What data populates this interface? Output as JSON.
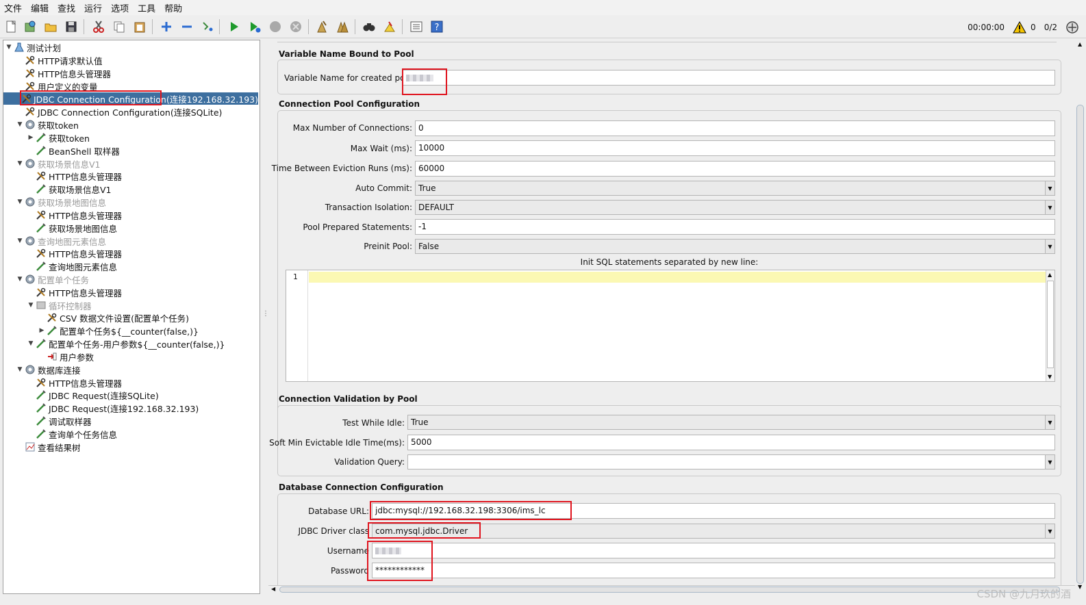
{
  "menu": [
    "文件",
    "编辑",
    "查找",
    "运行",
    "选项",
    "工具",
    "帮助"
  ],
  "toolbar": {
    "icons": [
      "new-icon",
      "templates-icon",
      "open-icon",
      "save-icon",
      "cut-icon",
      "copy-icon",
      "paste-icon",
      "expand-icon",
      "collapse-icon",
      "toggle-icon",
      "start-icon",
      "start-no-pause-icon",
      "stop-icon",
      "shutdown-icon",
      "clear-icon",
      "clear-all-icon",
      "search-icon",
      "reset-search-icon",
      "function-helper-icon",
      "help-icon"
    ],
    "elapsed": "00:00:00",
    "warnings": "0",
    "threads": "0/2"
  },
  "tree": [
    {
      "label": "测试计划",
      "icon": "testplan-icon",
      "expander": "▼"
    },
    {
      "label": "HTTP请求默认值",
      "icon": "config-icon"
    },
    {
      "label": "HTTP信息头管理器",
      "icon": "config-icon"
    },
    {
      "label": "用户定义的变量",
      "icon": "config-icon"
    },
    {
      "label": "JDBC Connection Configuration(连接192.168.32.193)",
      "icon": "config-icon"
    },
    {
      "label": "JDBC Connection Configuration(连接SQLite)",
      "icon": "config-icon"
    },
    {
      "label": "获取token",
      "icon": "threadgroup-icon",
      "expander": "▼"
    },
    {
      "label": "获取token",
      "icon": "sampler-icon",
      "expander": "▶"
    },
    {
      "label": "BeanShell 取样器",
      "icon": "sampler-icon"
    },
    {
      "label": "获取场景信息V1",
      "icon": "threadgroup-icon",
      "expander": "▼"
    },
    {
      "label": "HTTP信息头管理器",
      "icon": "config-icon"
    },
    {
      "label": "获取场景信息V1",
      "icon": "sampler-icon"
    },
    {
      "label": "获取场景地图信息",
      "icon": "threadgroup-icon",
      "expander": "▼"
    },
    {
      "label": "HTTP信息头管理器",
      "icon": "config-icon"
    },
    {
      "label": "获取场景地图信息",
      "icon": "sampler-icon"
    },
    {
      "label": "查询地图元素信息",
      "icon": "threadgroup-icon",
      "expander": "▼"
    },
    {
      "label": "HTTP信息头管理器",
      "icon": "config-icon"
    },
    {
      "label": "查询地图元素信息",
      "icon": "sampler-icon"
    },
    {
      "label": "配置单个任务",
      "icon": "threadgroup-icon",
      "expander": "▼"
    },
    {
      "label": "HTTP信息头管理器",
      "icon": "config-icon"
    },
    {
      "label": "循环控制器",
      "icon": "loop-icon",
      "expander": "▼"
    },
    {
      "label": "CSV 数据文件设置(配置单个任务)",
      "icon": "config-icon"
    },
    {
      "label": "配置单个任务${__counter(false,)}",
      "icon": "sampler-icon",
      "expander": "▶"
    },
    {
      "label": "配置单个任务-用户参数${__counter(false,)}",
      "icon": "sampler-icon",
      "expander": "▼"
    },
    {
      "label": "用户参数",
      "icon": "preprocessor-icon"
    },
    {
      "label": "数据库连接",
      "icon": "threadgroup-icon",
      "expander": "▼"
    },
    {
      "label": "HTTP信息头管理器",
      "icon": "config-icon"
    },
    {
      "label": "JDBC Request(连接SQLite)",
      "icon": "sampler-icon"
    },
    {
      "label": "JDBC Request(连接192.168.32.193)",
      "icon": "sampler-icon"
    },
    {
      "label": "调试取样器",
      "icon": "sampler-icon"
    },
    {
      "label": "查询单个任务信息",
      "icon": "sampler-icon"
    },
    {
      "label": "查看结果树",
      "icon": "listener-icon"
    }
  ],
  "panel": {
    "pool_section": "Variable Name Bound to Pool",
    "pool_var_label": "Variable Name for created pool:",
    "pool_config_section": "Connection Pool Configuration",
    "max_conn_label": "Max Number of Connections:",
    "max_conn_value": "0",
    "max_wait_label": "Max Wait (ms):",
    "max_wait_value": "10000",
    "eviction_label": "Time Between Eviction Runs (ms):",
    "eviction_value": "60000",
    "auto_commit_label": "Auto Commit:",
    "auto_commit_value": "True",
    "isolation_label": "Transaction Isolation:",
    "isolation_value": "DEFAULT",
    "prepared_label": "Pool Prepared Statements:",
    "prepared_value": "-1",
    "preinit_label": "Preinit Pool:",
    "preinit_value": "False",
    "init_sql_label": "Init SQL statements separated by new line:",
    "line_number": "1",
    "validation_section": "Connection Validation by Pool",
    "test_idle_label": "Test While Idle:",
    "test_idle_value": "True",
    "soft_min_label": "Soft Min Evictable Idle Time(ms):",
    "soft_min_value": "5000",
    "validation_query_label": "Validation Query:",
    "validation_query_value": "",
    "db_section": "Database Connection Configuration",
    "db_url_label": "Database URL:",
    "db_url_value": "jdbc:mysql://192.168.32.198:3306/ims_lc",
    "driver_label": "JDBC Driver class",
    "driver_value": "com.mysql.jdbc.Driver",
    "username_label": "Username",
    "password_label": "Password",
    "password_value": "************"
  },
  "watermark": "CSDN @九月玖的酒"
}
